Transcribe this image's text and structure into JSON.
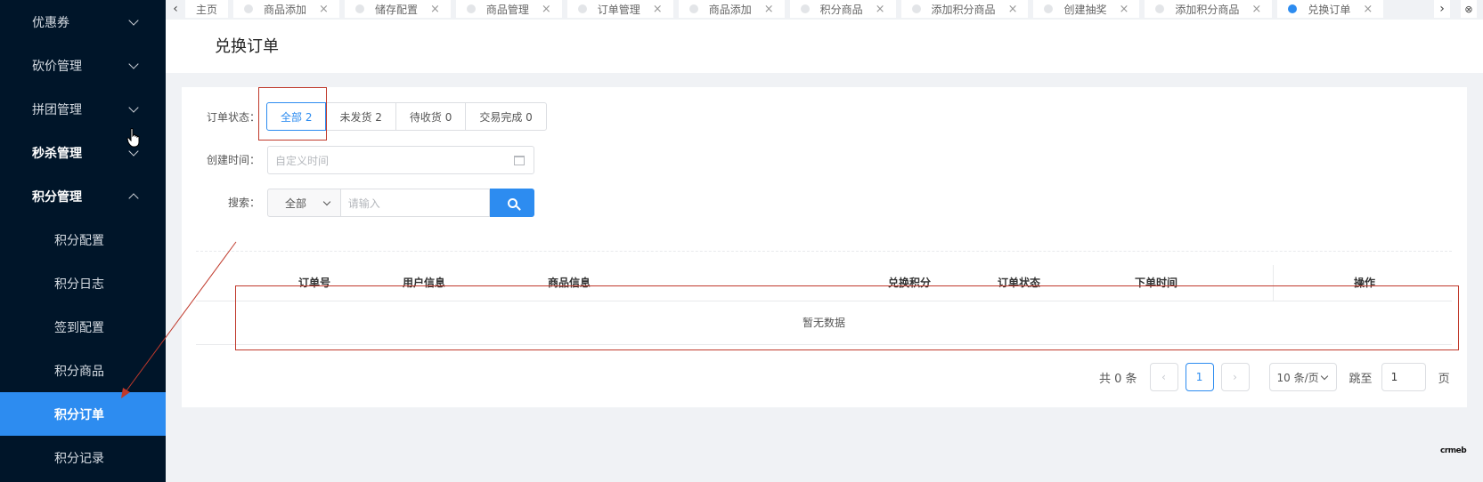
{
  "sidebar": {
    "items": [
      {
        "label": "优惠券",
        "expanded": false
      },
      {
        "label": "砍价管理",
        "expanded": false
      },
      {
        "label": "拼团管理",
        "expanded": false
      },
      {
        "label": "秒杀管理",
        "expanded": false
      },
      {
        "label": "积分管理",
        "expanded": true
      }
    ],
    "subitems": [
      {
        "label": "积分配置"
      },
      {
        "label": "积分日志"
      },
      {
        "label": "签到配置"
      },
      {
        "label": "积分商品"
      },
      {
        "label": "积分订单"
      },
      {
        "label": "积分记录"
      }
    ],
    "active_subitem": "积分订单"
  },
  "tabs": [
    "主页",
    "商品添加",
    "储存配置",
    "商品管理",
    "订单管理",
    "商品添加",
    "积分商品",
    "添加积分商品",
    "创建抽奖",
    "添加积分商品",
    "兑换订单"
  ],
  "active_tab": "兑换订单",
  "page": {
    "title": "兑换订单"
  },
  "filters": {
    "status_label": "订单状态：",
    "status_options": [
      "全部 2",
      "未发货 2",
      "待收货 0",
      "交易完成 0"
    ],
    "time_label": "创建时间：",
    "time_placeholder": "自定义时间",
    "search_label": "搜索：",
    "search_scope": "全部",
    "search_placeholder": "请输入"
  },
  "table": {
    "columns": [
      "订单号",
      "用户信息",
      "商品信息",
      "兑换积分",
      "订单状态",
      "下单时间",
      "操作"
    ],
    "empty_text": "暂无数据"
  },
  "pagination": {
    "total_text": "共 0 条",
    "current_page": "1",
    "page_size": "10 条/页",
    "jump_label": "跳至",
    "jump_value": "1",
    "page_suffix": "页"
  },
  "logo_text": "crmeb",
  "colors": {
    "sidebar_bg": "#001529",
    "accent": "#2d8cf0",
    "annotation": "#c0392b"
  }
}
